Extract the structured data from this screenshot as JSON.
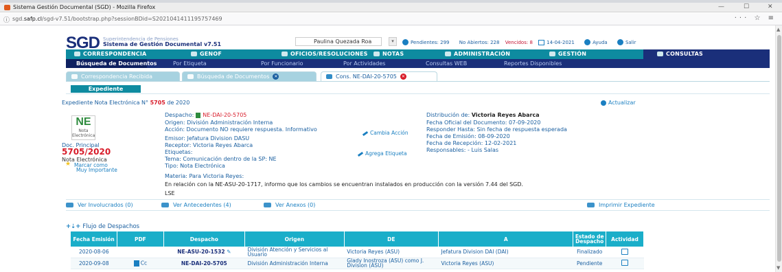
{
  "browser": {
    "window_title": "Sistema Gestión Documental (SGD) - Mozilla Firefox",
    "url_prefix": "sgd.",
    "url_host": "safp.cl",
    "url_path": "/sgd-v7.51/bootstrap.php?sessionBDid=S2021041411195757469",
    "controls": [
      "—",
      "☐",
      "✕"
    ],
    "tools": "··· ☆ ≡"
  },
  "header": {
    "logo": "SGD",
    "subtitle": "Superintendencia de Pensiones",
    "app_name": "Sistema de Gestión Documental v7.51",
    "user": "Paulina Quezada Roa",
    "pendientes": "Pendientes: 299",
    "no_abiertos": "No Abiertos: 228",
    "vencidos": "Vencidos: 8",
    "date": "14-04-2021",
    "ayuda": "Ayuda",
    "salir": "Salir"
  },
  "mainnav": {
    "correspondencia": "CORRESPONDENCIA",
    "genof": "GENOF",
    "oficios": "OFICIOS/RESOLUCIONES",
    "notas": "NOTAS",
    "administracion": "ADMINISTRACIÓN",
    "gestion": "GESTIÓN",
    "consultas": "CONSULTAS"
  },
  "subnav": {
    "busqueda": "Búsqueda de Documentos",
    "etiqueta": "Por Etiqueta",
    "funcionario": "Por Funcionario",
    "actividades": "Por Actividades",
    "web": "Consultas WEB",
    "reportes": "Reportes Disponibles"
  },
  "tabs": {
    "recibida": "Correspondencia Recibida",
    "busqueda": "Búsqueda de Documentos",
    "cons": "Cons. NE-DAI-20-5705"
  },
  "expediente_button": "Expediente",
  "expediente": {
    "title_prefix": "Expediente Nota Electrónica N°",
    "number": "5705",
    "title_suffix": "de 2020",
    "actualizar": "Actualizar"
  },
  "doc_card": {
    "icon_big": "NE",
    "icon_line1": "Nota",
    "icon_line2": "Electrónica",
    "principal_label": "Doc. Principal",
    "number": "5705/2020",
    "type": "Nota Electrónica",
    "marcar_line1": "Marcar como",
    "marcar_line2": "Muy Importante"
  },
  "details": {
    "despacho_label": "Despacho:",
    "despacho_value": "NE-DAI-20-5705",
    "origen": "Origen: División Administración Interna",
    "accion": "Acción: Documento NO requiere respuesta. Informativo",
    "emisor": "Emisor: Jefatura Division DASU",
    "receptor": "Receptor: Victoria Reyes Abarca",
    "etiquetas": "Etiquetas:",
    "tema": "Tema: Comunicación dentro de la SP: NE",
    "tipo": "Tipo: Nota Electrónica",
    "materia": "Materia: Para Victoria Reyes:",
    "materia_text": "En relación con la NE-ASU-20-1717, informo que los cambios se encuentran instalados en producción con la versión 7.44 del SGD.",
    "sign": "LSE",
    "cambia_accion": "Cambia Acción",
    "agrega_etiqueta": "Agrega Etiqueta"
  },
  "right_details": {
    "distribucion_label": "Distribución de:",
    "distribucion_value": "Victoria Reyes Abarca",
    "fecha_oficial": "Fecha Oficial del Documento: 07-09-2020",
    "responder": "Responder Hasta: Sin fecha de respuesta esperada",
    "emision": "Fecha de Emisión: 08-09-2020",
    "recepcion": "Fecha de Recepción: 12-02-2021",
    "responsables": "Responsables:   - Luis Salas"
  },
  "links": {
    "involucrados": "Ver Involucrados (0)",
    "antecedentes": "Ver Antecedentes (4)",
    "anexos": "Ver Anexos (0)",
    "imprimir": "Imprimir Expediente"
  },
  "flujo_title": "Flujo de Despachos",
  "table": {
    "headers": [
      "Fecha Emisión",
      "PDF",
      "Despacho",
      "Origen",
      "DE",
      "A",
      "Estado de Despacho",
      "Actividad"
    ],
    "rows": [
      {
        "fecha": "2020-08-06",
        "pdf": "",
        "despacho": "NE-ASU-20-1532",
        "origen": "División Atención y Servicios al Usuario",
        "de": "Victoria Reyes (ASU)",
        "a": "Jefatura Division DAI (DAI)",
        "estado": "Finalizado"
      },
      {
        "fecha": "2020-09-08",
        "pdf": "Cc",
        "despacho": "NE-DAI-20-5705",
        "origen": "División Administración Interna",
        "de": "Glady Inostroza (ASU) como J. Division (ASU)",
        "a": "Victoria Reyes (ASU)",
        "estado": "Pendiente"
      }
    ]
  }
}
